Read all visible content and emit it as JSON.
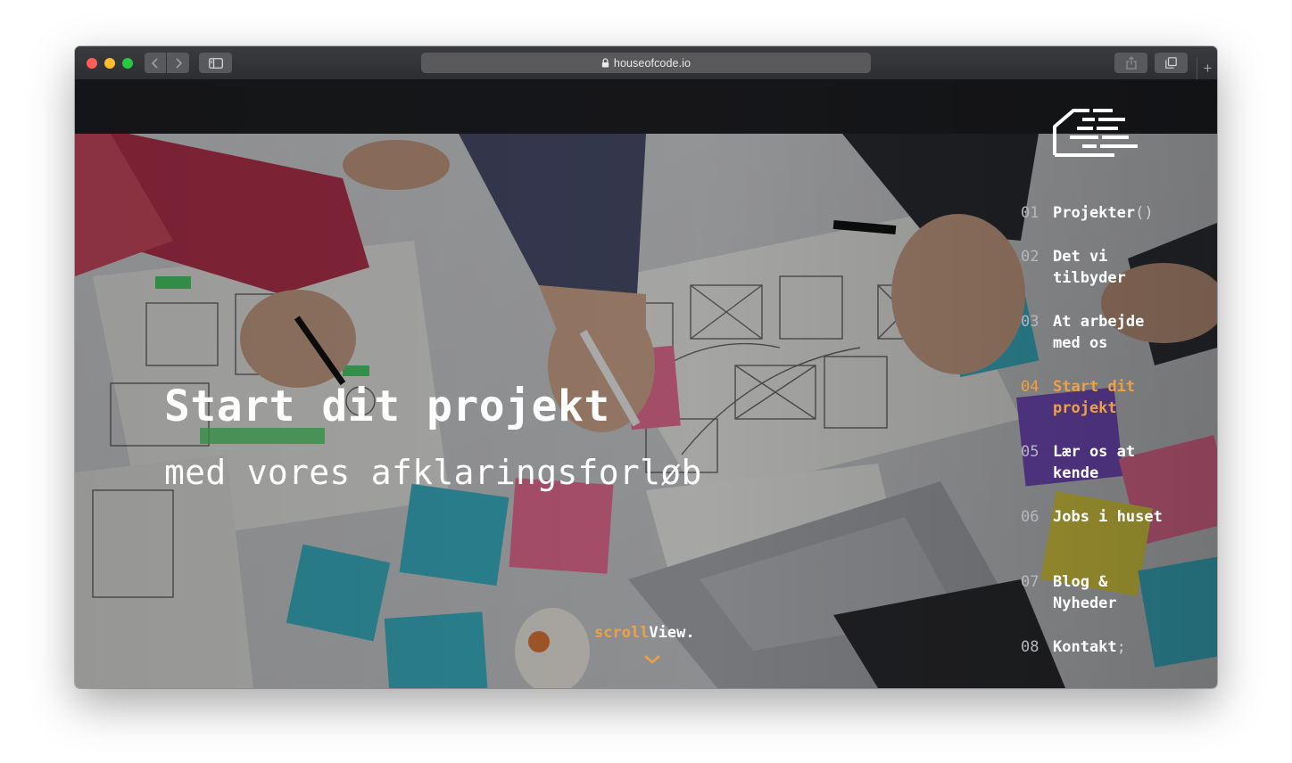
{
  "browser": {
    "url": "houseofcode.io",
    "icons": {
      "back": "chevron-left-icon",
      "forward": "chevron-right-icon",
      "sidebar": "sidebar-icon",
      "lock": "lock-icon",
      "share": "share-icon",
      "tabs": "tabs-icon",
      "new_tab": "plus-icon"
    },
    "new_tab_symbol": "+"
  },
  "hero": {
    "title": "Start dit projekt",
    "subtitle": "med vores afklaringsforløb"
  },
  "nav": {
    "items": [
      {
        "num": "01",
        "label": "Projekter",
        "suffix": "()",
        "active": false
      },
      {
        "num": "02",
        "label": "Det vi tilbyder",
        "active": false
      },
      {
        "num": "03",
        "label": "At arbejde med os",
        "active": false
      },
      {
        "num": "04",
        "label": "Start dit projekt",
        "active": true
      },
      {
        "num": "05",
        "label": "Lær os at kende",
        "active": false
      },
      {
        "num": "06",
        "label": "Jobs i huset",
        "active": false
      },
      {
        "num": "07",
        "label": "Blog & Nyheder",
        "active": false
      },
      {
        "num": "08",
        "label": "Kontakt",
        "suffix": ";",
        "active": false
      }
    ]
  },
  "scroll": {
    "prefix": "scroll",
    "suffix": "View.",
    "icon": "chevron-down-icon"
  },
  "colors": {
    "accent": "#f0a044",
    "text": "#ffffff",
    "nav_number": "#b7b8bc"
  }
}
